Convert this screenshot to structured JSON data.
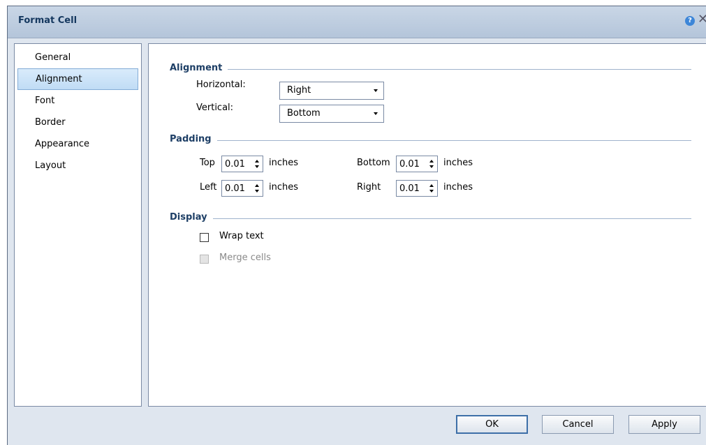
{
  "dialog": {
    "title": "Format Cell"
  },
  "sidebar": {
    "items": [
      {
        "label": "General"
      },
      {
        "label": "Alignment",
        "selected": true
      },
      {
        "label": "Font"
      },
      {
        "label": "Border"
      },
      {
        "label": "Appearance"
      },
      {
        "label": "Layout"
      }
    ]
  },
  "alignment": {
    "header": "Alignment",
    "horizontal_label": "Horizontal:",
    "horizontal_value": "Right",
    "vertical_label": "Vertical:",
    "vertical_value": "Bottom"
  },
  "padding": {
    "header": "Padding",
    "top_label": "Top",
    "top_value": "0.01",
    "left_label": "Left",
    "left_value": "0.01",
    "bottom_label": "Bottom",
    "bottom_value": "0.01",
    "right_label": "Right",
    "right_value": "0.01",
    "unit": "inches"
  },
  "display": {
    "header": "Display",
    "wrap_text_label": "Wrap text",
    "wrap_text_checked": false,
    "merge_cells_label": "Merge cells",
    "merge_cells_enabled": false
  },
  "buttons": {
    "ok": "OK",
    "cancel": "Cancel",
    "apply": "Apply"
  },
  "colors": {
    "title_text": "#15385f",
    "section_header": "#1e3f66",
    "selection": "#c0dcf5"
  }
}
